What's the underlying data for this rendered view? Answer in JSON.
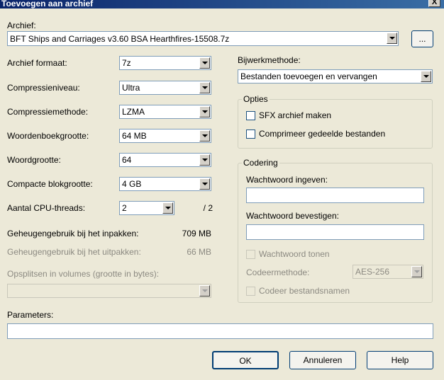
{
  "window": {
    "title": "Toevoegen aan archief",
    "close_label": "X"
  },
  "archive": {
    "label": "Archief:",
    "value": "BFT Ships and Carriages v3.60 BSA Hearthfires-15508.7z",
    "browse_label": "..."
  },
  "left": {
    "format_label": "Archief formaat:",
    "format_value": "7z",
    "level_label": "Compressieniveau:",
    "level_value": "Ultra",
    "method_label": "Compressiemethode:",
    "method_value": "LZMA",
    "dict_label": "Woordenboekgrootte:",
    "dict_value": "64 MB",
    "word_label": "Woordgrootte:",
    "word_value": "64",
    "solid_label": "Compacte blokgrootte:",
    "solid_value": "4 GB",
    "cpu_label": "Aantal CPU-threads:",
    "cpu_value": "2",
    "cpu_total": "/ 2",
    "mem_pack_label": "Geheugengebruik bij het inpakken:",
    "mem_pack_value": "709 MB",
    "mem_unpack_label": "Geheugengebruik bij het uitpakken:",
    "mem_unpack_value": "66 MB",
    "split_label": "Opsplitsen in volumes (grootte in bytes):",
    "split_value": ""
  },
  "right": {
    "update_label": "Bijwerkmethode:",
    "update_value": "Bestanden toevoegen en vervangen",
    "options_title": "Opties",
    "sfx_label": "SFX archief maken",
    "shared_label": "Comprimeer gedeelde bestanden",
    "encryption_title": "Codering",
    "pw_label": "Wachtwoord ingeven:",
    "pw_value": "",
    "pw_confirm_label": "Wachtwoord bevestigen:",
    "pw_confirm_value": "",
    "show_pw_label": "Wachtwoord tonen",
    "enc_method_label": "Codeermethode:",
    "enc_method_value": "AES-256",
    "enc_names_label": "Codeer bestandsnamen"
  },
  "params": {
    "label": "Parameters:",
    "value": ""
  },
  "buttons": {
    "ok": "OK",
    "cancel": "Annuleren",
    "help": "Help"
  }
}
